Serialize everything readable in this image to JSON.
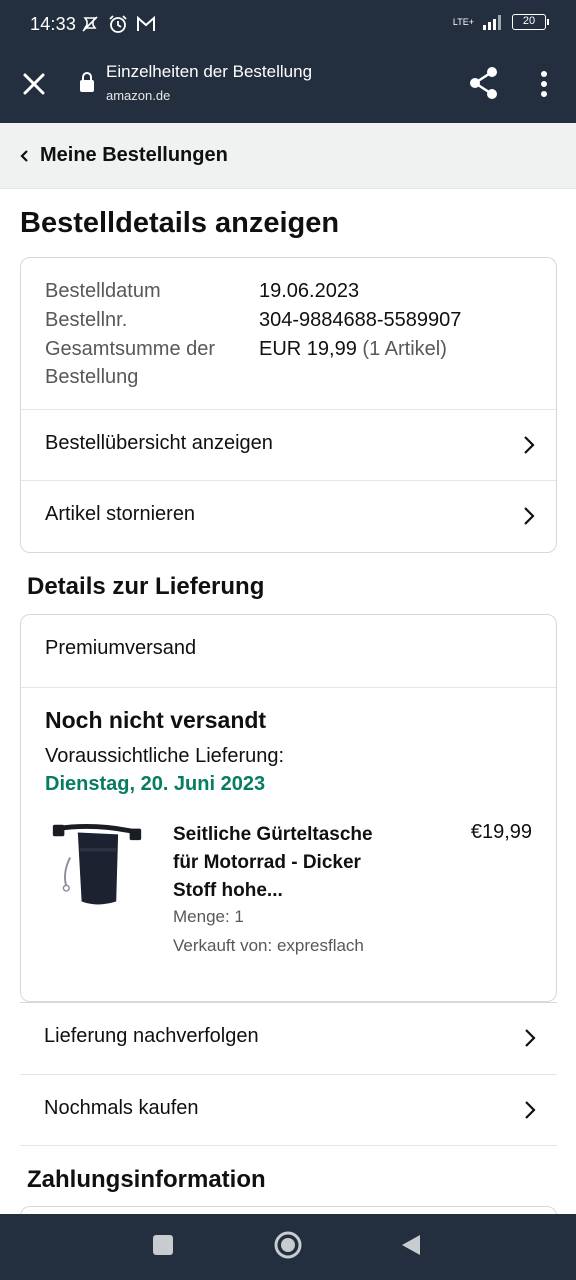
{
  "status_bar": {
    "time": "14:33",
    "network": "LTE+",
    "battery": "20"
  },
  "toolbar": {
    "title": "Einzelheiten der Bestellung",
    "url": "amazon.de"
  },
  "breadcrumb": {
    "label": "Meine Bestellungen"
  },
  "page": {
    "title": "Bestelldetails anzeigen"
  },
  "order_summary": {
    "date_label": "Bestelldatum",
    "date_value": "19.06.2023",
    "number_label": "Bestellnr.",
    "number_value": "304-9884688-5589907",
    "total_label_line1": "Gesamtsumme der",
    "total_label_line2": "Bestellung",
    "total_value": "EUR 19,99",
    "total_items": "(1 Artikel)",
    "actions": [
      {
        "label": "Bestellübersicht anzeigen"
      },
      {
        "label": "Artikel stornieren"
      }
    ]
  },
  "delivery": {
    "heading": "Details zur Lieferung",
    "shipping_method": "Premiumversand",
    "status": "Noch nicht versandt",
    "expected_label": "Voraussichtliche Lieferung:",
    "expected_date": "Dienstag, 20. Juni 2023",
    "item": {
      "title_line1": "Seitliche Gürteltasche",
      "title_line2": "für Motorrad - Dicker",
      "title_line3": "Stoff hohe...",
      "price": "€19,99",
      "quantity": "Menge: 1",
      "seller": "Verkauft von: expresflach"
    },
    "actions": [
      {
        "label": "Lieferung nachverfolgen"
      },
      {
        "label": "Nochmals kaufen"
      }
    ]
  },
  "payment": {
    "heading": "Zahlungsinformation"
  },
  "colors": {
    "header_bg": "#232f3e",
    "green_date": "#067d62",
    "breadcrumb_bg": "#f0f2f2"
  }
}
